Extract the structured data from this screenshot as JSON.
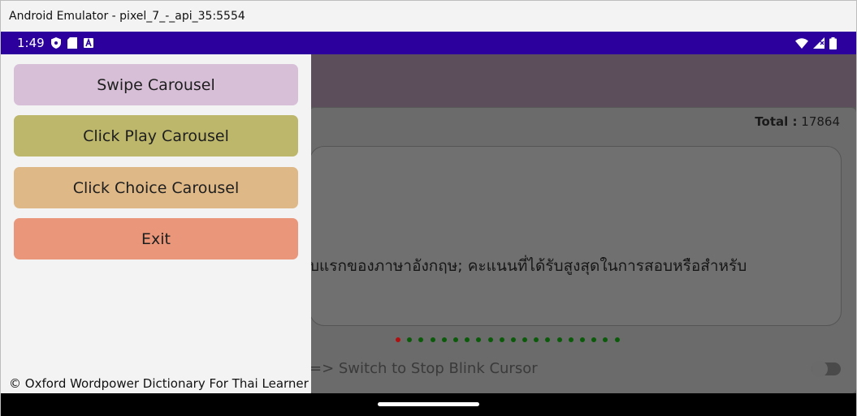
{
  "window": {
    "title": "Android Emulator - pixel_7_-_api_35:5554"
  },
  "status_bar": {
    "time": "1:49",
    "left_icons": [
      "shield-icon",
      "sd-card-icon",
      "a-box-icon"
    ],
    "right_icons": [
      "wifi-icon",
      "signal-icon",
      "battery-icon"
    ]
  },
  "drawer": {
    "buttons": [
      {
        "label": "Swipe Carousel",
        "color": "#d8bfd8"
      },
      {
        "label": "Click Play Carousel",
        "color": "#bdb76b"
      },
      {
        "label": "Click Choice Carousel",
        "color": "#deb887"
      },
      {
        "label": "Exit",
        "color": "#e9967a"
      }
    ],
    "copyright": "© Oxford Wordpower Dictionary For Thai Learner"
  },
  "content": {
    "total_label": "Total :",
    "total_value": "17864",
    "definition_text": "บแรกของภาษาอังกฤษ; คะแนนที่ได้รับสูงสุดในการสอบหรือสำหรับ",
    "switch_label": "=> Switch to Stop Blink Cursor",
    "switch_on": false,
    "carousel_dots": {
      "count": 20,
      "active_index": 0,
      "active_color": "#b01010",
      "dot_color": "#0a5a0a"
    }
  }
}
